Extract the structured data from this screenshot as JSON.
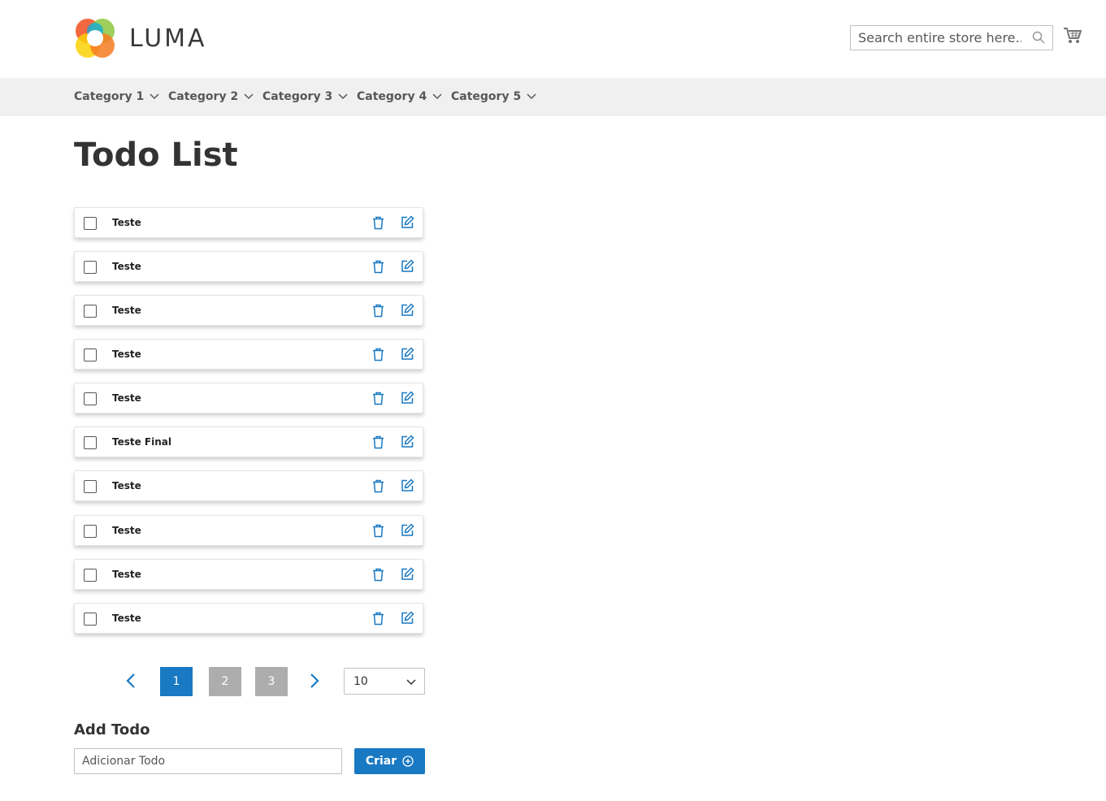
{
  "header": {
    "logo_text": "LUMA",
    "search_placeholder": "Search entire store here...",
    "search_icon": "search-icon",
    "cart_icon": "cart-icon"
  },
  "nav": {
    "items": [
      {
        "label": "Category 1"
      },
      {
        "label": "Category 2"
      },
      {
        "label": "Category 3"
      },
      {
        "label": "Category 4"
      },
      {
        "label": "Category 5"
      }
    ]
  },
  "page_title": "Todo List",
  "todos": [
    {
      "label": "Teste",
      "checked": false
    },
    {
      "label": "Teste",
      "checked": false
    },
    {
      "label": "Teste",
      "checked": false
    },
    {
      "label": "Teste",
      "checked": false
    },
    {
      "label": "Teste",
      "checked": false
    },
    {
      "label": "Teste Final",
      "checked": false
    },
    {
      "label": "Teste",
      "checked": false
    },
    {
      "label": "Teste",
      "checked": false
    },
    {
      "label": "Teste",
      "checked": false
    },
    {
      "label": "Teste",
      "checked": false
    }
  ],
  "pagination": {
    "pages": [
      "1",
      "2",
      "3"
    ],
    "current_page": "1",
    "per_page": "10"
  },
  "add_todo": {
    "title": "Add Todo",
    "placeholder": "Adicionar Todo",
    "button_label": "Criar"
  },
  "colors": {
    "accent": "#1979c3",
    "inactive_page": "#adadad",
    "nav_bg": "#f0f0f0"
  }
}
